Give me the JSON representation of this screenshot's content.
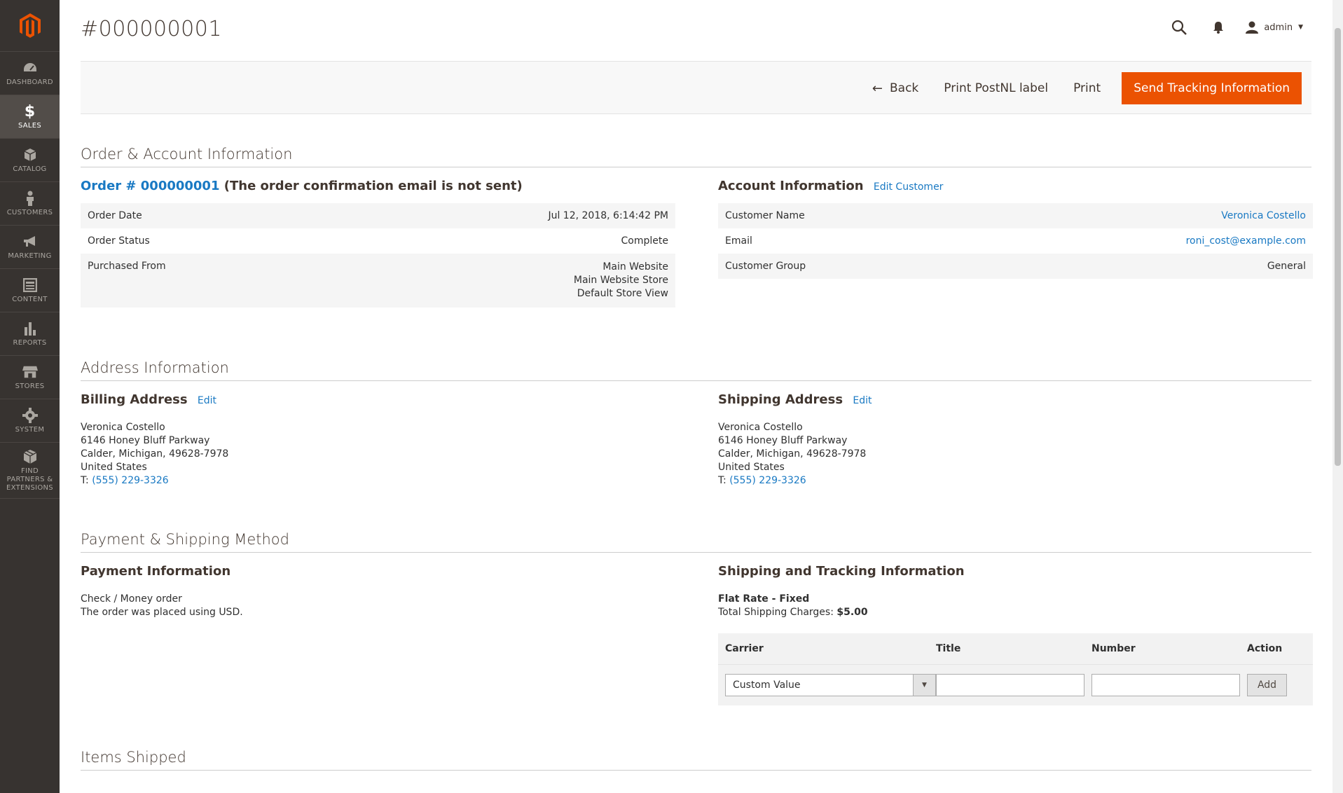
{
  "sidebar": {
    "items": [
      {
        "label": "DASHBOARD",
        "icon": "dashboard-icon"
      },
      {
        "label": "SALES",
        "icon": "dollar-icon",
        "active": true
      },
      {
        "label": "CATALOG",
        "icon": "cube-icon"
      },
      {
        "label": "CUSTOMERS",
        "icon": "person-icon"
      },
      {
        "label": "MARKETING",
        "icon": "megaphone-icon"
      },
      {
        "label": "CONTENT",
        "icon": "layout-icon"
      },
      {
        "label": "REPORTS",
        "icon": "bar-chart-icon"
      },
      {
        "label": "STORES",
        "icon": "store-icon"
      },
      {
        "label": "SYSTEM",
        "icon": "gear-icon"
      },
      {
        "label": "FIND PARTNERS & EXTENSIONS",
        "icon": "boxes-icon"
      }
    ]
  },
  "header": {
    "title": "#000000001",
    "user": "admin"
  },
  "actions": {
    "back": "Back",
    "print_postnl": "Print PostNL label",
    "print": "Print",
    "send_tracking": "Send Tracking Information"
  },
  "order_account": {
    "section_title": "Order & Account Information",
    "order_link": "Order # 000000001",
    "order_note": "(The order confirmation email is not sent)",
    "order_rows": [
      {
        "label": "Order Date",
        "value": "Jul 12, 2018, 6:14:42 PM"
      },
      {
        "label": "Order Status",
        "value": "Complete"
      },
      {
        "label": "Purchased From",
        "lines": [
          "Main Website",
          "Main Website Store",
          "Default Store View"
        ]
      }
    ],
    "account_title": "Account Information",
    "edit_customer": "Edit Customer",
    "account_rows": [
      {
        "label": "Customer Name",
        "value": "Veronica Costello"
      },
      {
        "label": "Email",
        "value": "roni_cost@example.com"
      },
      {
        "label": "Customer Group",
        "value": "General"
      }
    ]
  },
  "address": {
    "section_title": "Address Information",
    "billing_title": "Billing Address",
    "shipping_title": "Shipping Address",
    "edit": "Edit",
    "billing": {
      "name": "Veronica Costello",
      "street": "6146 Honey Bluff Parkway",
      "city": "Calder, Michigan, 49628-7978",
      "country": "United States",
      "phone_prefix": "T: ",
      "phone": "(555) 229-3326"
    },
    "shipping": {
      "name": "Veronica Costello",
      "street": "6146 Honey Bluff Parkway",
      "city": "Calder, Michigan, 49628-7978",
      "country": "United States",
      "phone_prefix": "T: ",
      "phone": "(555) 229-3326"
    }
  },
  "payment_shipping": {
    "section_title": "Payment & Shipping Method",
    "payment_title": "Payment Information",
    "payment_method": "Check / Money order",
    "payment_note": "The order was placed using USD.",
    "shipping_title": "Shipping and Tracking Information",
    "shipping_method": "Flat Rate - Fixed",
    "shipping_charges_label": "Total Shipping Charges: ",
    "shipping_charges_value": "$5.00",
    "tracking": {
      "headers": {
        "carrier": "Carrier",
        "title": "Title",
        "number": "Number",
        "action": "Action"
      },
      "carrier_value": "Custom Value",
      "title_value": "",
      "number_value": "",
      "add_label": "Add"
    }
  },
  "items_shipped": {
    "section_title": "Items Shipped"
  },
  "colors": {
    "sidebar_bg": "#373330",
    "accent": "#eb5202",
    "link": "#1979c3"
  }
}
